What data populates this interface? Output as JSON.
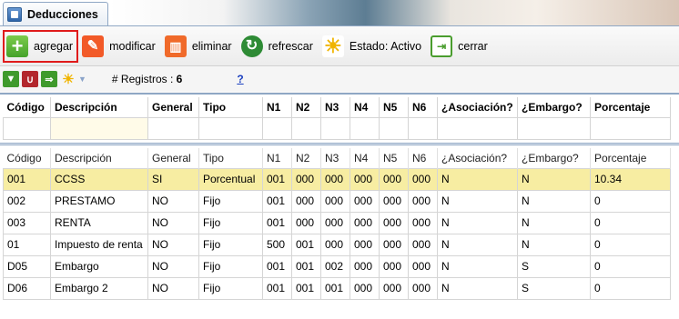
{
  "tab": {
    "title": "Deducciones"
  },
  "toolbar": [
    {
      "label": "agregar",
      "icon": "plus-icon",
      "selected": true
    },
    {
      "label": "modificar",
      "icon": "pencil-icon"
    },
    {
      "label": "eliminar",
      "icon": "trash-icon"
    },
    {
      "label": "refrescar",
      "icon": "refresh-icon"
    },
    {
      "label": "Estado: Activo",
      "icon": "sun-icon"
    },
    {
      "label": "cerrar",
      "icon": "document-exit-icon"
    }
  ],
  "subbar": {
    "registros_label": "# Registros :",
    "registros_count": "6",
    "help": "?"
  },
  "filter_headers": [
    "Código",
    "Descripción",
    "General",
    "Tipo",
    "N1",
    "N2",
    "N3",
    "N4",
    "N5",
    "N6",
    "¿Asociación?",
    "¿Embargo?",
    "Porcentaje"
  ],
  "headers": [
    "Código",
    "Descripción",
    "General",
    "Tipo",
    "N1",
    "N2",
    "N3",
    "N4",
    "N5",
    "N6",
    "¿Asociación?",
    "¿Embargo?",
    "Porcentaje"
  ],
  "rows": [
    [
      "001",
      "CCSS",
      "SI",
      "Porcentual",
      "001",
      "000",
      "000",
      "000",
      "000",
      "000",
      "N",
      "N",
      "10.34"
    ],
    [
      "002",
      "PRESTAMO",
      "NO",
      "Fijo",
      "001",
      "000",
      "000",
      "000",
      "000",
      "000",
      "N",
      "N",
      "0"
    ],
    [
      "003",
      "RENTA",
      "NO",
      "Fijo",
      "001",
      "000",
      "000",
      "000",
      "000",
      "000",
      "N",
      "N",
      "0"
    ],
    [
      "01",
      "Impuesto de renta",
      "NO",
      "Fijo",
      "500",
      "001",
      "000",
      "000",
      "000",
      "000",
      "N",
      "N",
      "0"
    ],
    [
      "D05",
      "Embargo",
      "NO",
      "Fijo",
      "001",
      "001",
      "002",
      "000",
      "000",
      "000",
      "N",
      "S",
      "0"
    ],
    [
      "D06",
      "Embargo 2",
      "NO",
      "Fijo",
      "001",
      "001",
      "001",
      "000",
      "000",
      "000",
      "N",
      "S",
      "0"
    ]
  ],
  "highlight_row": 0
}
